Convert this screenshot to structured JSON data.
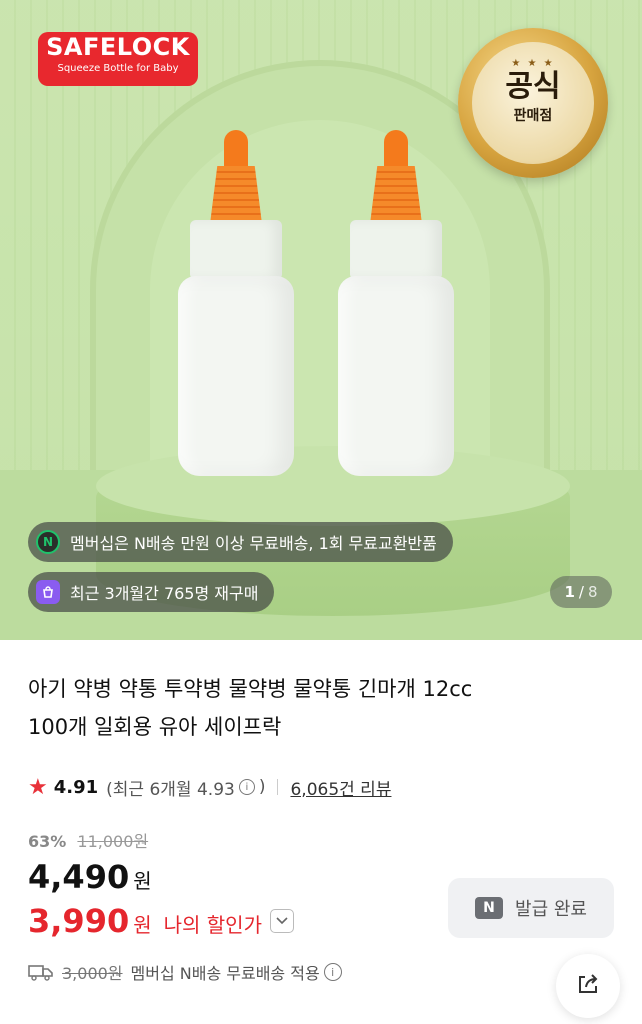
{
  "hero": {
    "logo": {
      "brand": "SAFELOCK",
      "tagline": "Squeeze Bottle for Baby"
    },
    "badge": {
      "line1": "공식",
      "line2": "판매점"
    },
    "chips": [
      {
        "icon": "naver-membership-icon",
        "text": "멤버십은 N배송 만원 이상 무료배송, 1회 무료교환반품"
      },
      {
        "icon": "repurchase-bag-icon",
        "text": "최근 3개월간 765명 재구매"
      }
    ],
    "pager": {
      "current": "1",
      "separator": "/",
      "total": "8"
    }
  },
  "product": {
    "title_line1": "아기 약병 약통 투약병 물약병 물약통 긴마개 12cc",
    "title_line2": "100개 일회용 유아 세이프락"
  },
  "rating": {
    "score": "4.91",
    "recent_prefix": "(최근 6개월 4.93",
    "recent_suffix": ")",
    "reviews": "6,065건 리뷰"
  },
  "pricing": {
    "discount_pct": "63%",
    "original_price": "11,000원",
    "price": "4,490",
    "currency": "원",
    "my_price": "3,990",
    "my_price_label": "나의 할인가"
  },
  "coupon": {
    "logo": "N",
    "label": "발급 완료"
  },
  "shipping": {
    "old_fee": "3,000원",
    "text": "멤버십 N배송 무료배송 적용"
  },
  "colors": {
    "accent_red": "#e5262d",
    "hero_green": "#c3e0a6",
    "brand_red": "#e8282e",
    "naver_green": "#1fc26b"
  }
}
